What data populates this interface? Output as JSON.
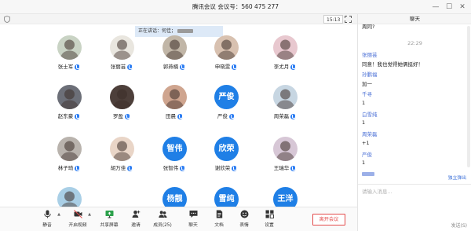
{
  "window": {
    "title": "腾讯会议  会议号：560 475 277",
    "controls": {
      "minimize": "—",
      "maximize": "☐",
      "close": "✕"
    }
  },
  "strip": {
    "timer": "15:13"
  },
  "speaking": {
    "label": "正在讲话：何佳；"
  },
  "participants": [
    {
      "name": "张士军",
      "avatar": "photo",
      "mic": true
    },
    {
      "name": "张丽芸",
      "avatar": "photo",
      "mic": true
    },
    {
      "name": "郭燕楠",
      "avatar": "photo",
      "mic": true
    },
    {
      "name": "申晓雯",
      "avatar": "photo",
      "mic": true
    },
    {
      "name": "李尤月",
      "avatar": "photo",
      "mic": true
    },
    {
      "name": "赵东豪",
      "avatar": "photo",
      "mic": true
    },
    {
      "name": "罗盈",
      "avatar": "photo",
      "mic": true
    },
    {
      "name": "田晨",
      "avatar": "photo",
      "mic": true
    },
    {
      "name": "严俊",
      "avatar": "text",
      "initials": "严俊",
      "mic": true
    },
    {
      "name": "周荣磊",
      "avatar": "photo",
      "mic": true
    },
    {
      "name": "林子琦",
      "avatar": "photo",
      "mic": true
    },
    {
      "name": "胡万佳",
      "avatar": "photo",
      "mic": true
    },
    {
      "name": "张智伟",
      "avatar": "text",
      "initials": "智伟",
      "mic": true
    },
    {
      "name": "谢欣荣",
      "avatar": "text",
      "initials": "欣荣",
      "mic": true
    },
    {
      "name": "王瑞华",
      "avatar": "photo",
      "mic": true
    },
    {
      "name": "",
      "avatar": "photo",
      "mic": false
    },
    {
      "name": "",
      "avatar": "none",
      "mic": false
    },
    {
      "name": "",
      "avatar": "text",
      "initials": "杨靓",
      "mic": false
    },
    {
      "name": "",
      "avatar": "text",
      "initials": "雪纯",
      "mic": false
    },
    {
      "name": "",
      "avatar": "text",
      "initials": "王洋",
      "mic": false
    }
  ],
  "toolbar": {
    "mute": "静音",
    "video": "开启视频",
    "share": "共享屏幕",
    "invite": "邀请",
    "members": "成员(25)",
    "chat": "聊天",
    "docs": "文档",
    "reactions": "表情",
    "settings": "设置",
    "leave": "离开会议"
  },
  "chat": {
    "title": "聊天",
    "messages": [
      {
        "kind": "text",
        "text": "周同?"
      },
      {
        "kind": "time",
        "text": "22:29"
      },
      {
        "kind": "sender",
        "text": "张丽芸"
      },
      {
        "kind": "text",
        "text": "同意！我也觉得她俩挺好！"
      },
      {
        "kind": "sender",
        "text": "孙鹏福"
      },
      {
        "kind": "text",
        "text": "加一"
      },
      {
        "kind": "sender",
        "text": "千寻"
      },
      {
        "kind": "text",
        "text": "1"
      },
      {
        "kind": "sender",
        "text": "白雪纯"
      },
      {
        "kind": "text",
        "text": "1"
      },
      {
        "kind": "sender",
        "text": "周荣磊"
      },
      {
        "kind": "text",
        "text": "+1"
      },
      {
        "kind": "sender",
        "text": "严俊"
      },
      {
        "kind": "text",
        "text": "1"
      }
    ],
    "popout": "独立弹出",
    "placeholder": "请输入消息...",
    "send": "发送(S)"
  },
  "colors": {
    "accent": "#1f7fe6",
    "sender": "#4a6fd6",
    "leave": "#e34b4b"
  }
}
